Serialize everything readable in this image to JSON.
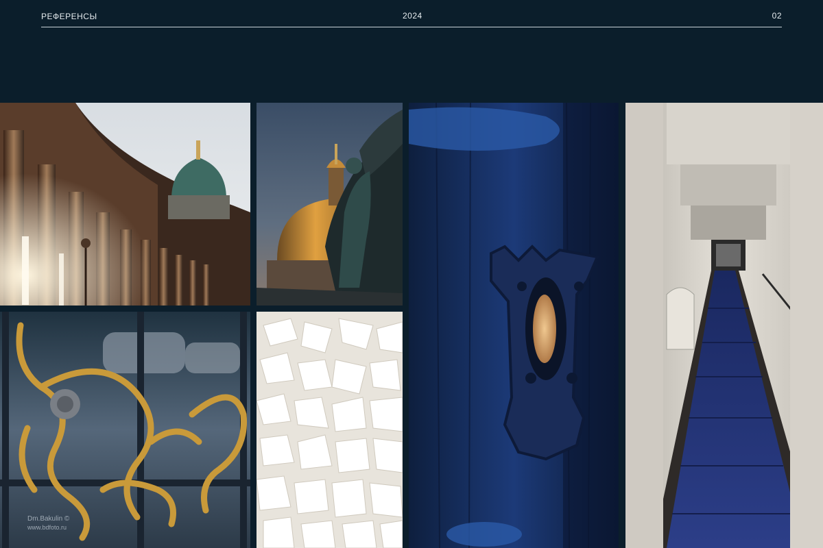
{
  "header": {
    "title": "РЕФЕРЕНСЫ",
    "year": "2024",
    "page_number": "02"
  },
  "theme": {
    "background": "#0b1e2b",
    "text": "#e6ecef",
    "rule": "#c9d3d9"
  },
  "gallery": {
    "images": [
      {
        "subject": "colonnade-with-green-dome",
        "icon": "cathedral-photo"
      },
      {
        "subject": "golden-dome-and-bronze-statue",
        "icon": "monument-photo"
      },
      {
        "subject": "gilded-wrought-iron-ornament",
        "icon": "ornament-photo"
      },
      {
        "subject": "white-wax-flakes",
        "icon": "texture-photo"
      },
      {
        "subject": "blue-door-with-keyhole",
        "icon": "keyhole-photo"
      },
      {
        "subject": "marble-staircase-blue-carpet",
        "icon": "staircase-photo"
      }
    ],
    "watermark": "Dm.Bakulin ©\nwww.bdfoto.ru"
  }
}
